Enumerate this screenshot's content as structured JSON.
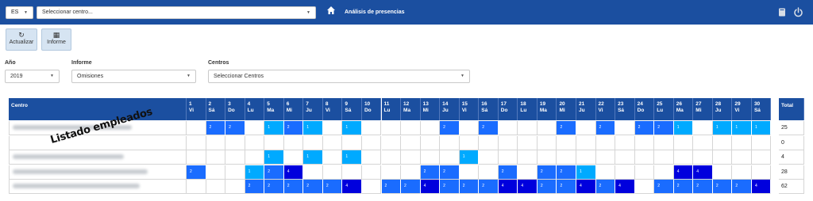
{
  "topbar": {
    "lang": "ES",
    "center_select": "Seleccionar centro...",
    "title": "Análisis de presencias"
  },
  "toolbar": {
    "refresh_label": "Actualizar",
    "report_label": "Informe"
  },
  "filters": {
    "year_label": "Año",
    "year_value": "2019",
    "report_label": "Informe",
    "report_value": "Omisiones",
    "centers_label": "Centros",
    "centers_value": "Seleccionar Centros"
  },
  "table": {
    "col_center": "Centro",
    "col_total": "Total",
    "days": [
      {
        "d": "1",
        "w": "Vi"
      },
      {
        "d": "2",
        "w": "Sá"
      },
      {
        "d": "3",
        "w": "Do"
      },
      {
        "d": "4",
        "w": "Lu"
      },
      {
        "d": "5",
        "w": "Ma"
      },
      {
        "d": "6",
        "w": "Mi"
      },
      {
        "d": "7",
        "w": "Ju"
      },
      {
        "d": "8",
        "w": "Vi"
      },
      {
        "d": "9",
        "w": "Sá"
      },
      {
        "d": "10",
        "w": "Do"
      },
      {
        "d": "11",
        "w": "Lu"
      },
      {
        "d": "12",
        "w": "Ma"
      },
      {
        "d": "13",
        "w": "Mi"
      },
      {
        "d": "14",
        "w": "Ju"
      },
      {
        "d": "15",
        "w": "Vi"
      },
      {
        "d": "16",
        "w": "Sá"
      },
      {
        "d": "17",
        "w": "Do"
      },
      {
        "d": "18",
        "w": "Lu"
      },
      {
        "d": "19",
        "w": "Ma"
      },
      {
        "d": "20",
        "w": "Mi"
      },
      {
        "d": "21",
        "w": "Ju"
      },
      {
        "d": "22",
        "w": "Vi"
      },
      {
        "d": "23",
        "w": "Sá"
      },
      {
        "d": "24",
        "w": "Do"
      },
      {
        "d": "25",
        "w": "Lu"
      },
      {
        "d": "26",
        "w": "Ma"
      },
      {
        "d": "27",
        "w": "Mi"
      },
      {
        "d": "28",
        "w": "Ju"
      },
      {
        "d": "29",
        "w": "Vi"
      },
      {
        "d": "30",
        "w": "Sá"
      }
    ],
    "levels": {
      "1": "#00aaff",
      "2": "#1a6cff",
      "4": "#0000dd"
    },
    "rows": [
      {
        "total": "25",
        "cells": [
          0,
          2,
          2,
          0,
          1,
          2,
          1,
          0,
          1,
          0,
          0,
          0,
          0,
          2,
          0,
          2,
          0,
          0,
          0,
          2,
          0,
          2,
          0,
          2,
          2,
          1,
          0,
          1,
          1,
          1
        ]
      },
      {
        "total": "0",
        "cells": [
          0,
          0,
          0,
          0,
          0,
          0,
          0,
          0,
          0,
          0,
          0,
          0,
          0,
          0,
          0,
          0,
          0,
          0,
          0,
          0,
          0,
          0,
          0,
          0,
          0,
          0,
          0,
          0,
          0,
          0
        ]
      },
      {
        "total": "4",
        "cells": [
          0,
          0,
          0,
          0,
          1,
          0,
          1,
          0,
          1,
          0,
          0,
          0,
          0,
          0,
          1,
          0,
          0,
          0,
          0,
          0,
          0,
          0,
          0,
          0,
          0,
          0,
          0,
          0,
          0,
          0
        ]
      },
      {
        "total": "28",
        "cells": [
          2,
          0,
          0,
          1,
          2,
          4,
          0,
          0,
          0,
          0,
          0,
          0,
          2,
          2,
          0,
          0,
          2,
          0,
          2,
          2,
          1,
          0,
          0,
          0,
          0,
          4,
          4,
          0,
          0,
          0
        ]
      },
      {
        "total": "62",
        "cells": [
          0,
          0,
          0,
          2,
          2,
          2,
          2,
          2,
          4,
          0,
          2,
          2,
          4,
          2,
          2,
          2,
          4,
          4,
          2,
          2,
          4,
          2,
          4,
          0,
          2,
          2,
          2,
          2,
          2,
          4
        ]
      }
    ]
  },
  "overlay_text": "Listado empleados"
}
